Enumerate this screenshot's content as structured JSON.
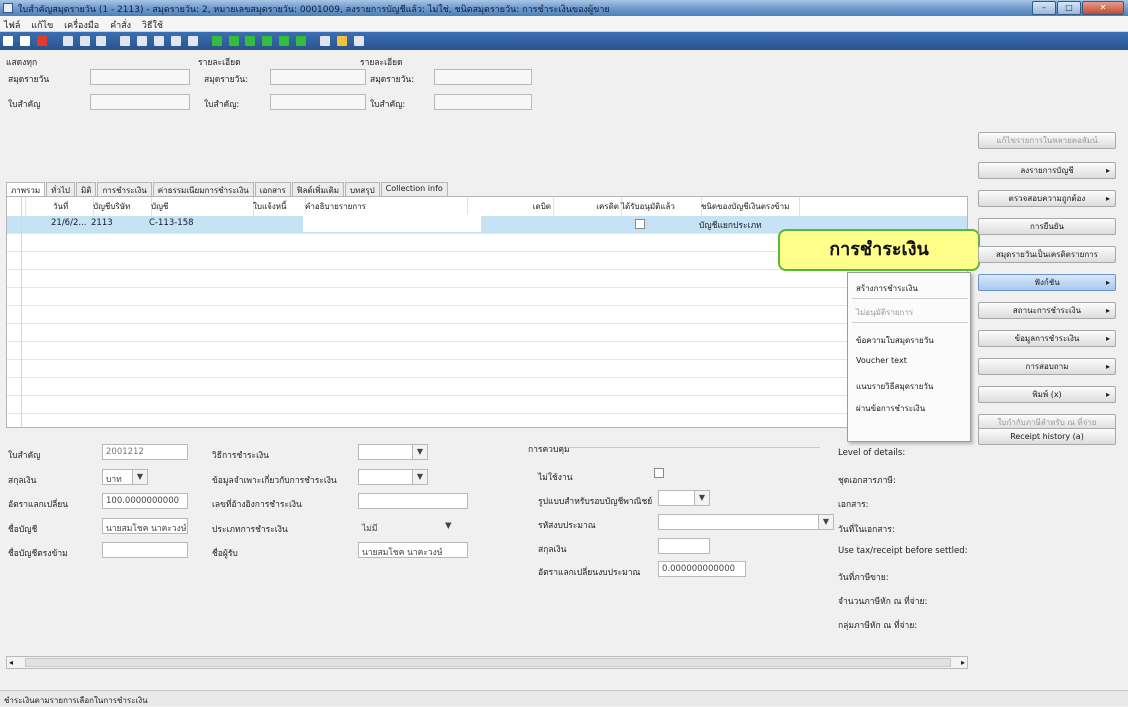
{
  "window": {
    "title": "ใบสำคัญสมุดรายวัน (1 - 2113) - สมุดรายวัน: 2, หมายเลขสมุดรายวัน: 0001009, ลงรายการบัญชีแล้ว: ไม่ใช่, ชนิดสมุดรายวัน: การชำระเงินของผู้ขาย",
    "controls": [
      "–",
      "□",
      "✕"
    ]
  },
  "menu": [
    "ไฟล์",
    "แก้ไข",
    "เครื่องมือ",
    "คำสั่ง",
    "วิธีใช้"
  ],
  "header_groups": {
    "g1": {
      "title": "แสดงทุก",
      "f1": "สมุดรายวัน",
      "f2": "ใบสำคัญ"
    },
    "g2": {
      "title": "รายละเอียด",
      "f1": "สมุดรายวัน:",
      "f2": "ใบสำคัญ:"
    },
    "g3": {
      "title": "รายละเอียด",
      "f1": "สมุดรายวัน:",
      "f2": "ใบสำคัญ:"
    }
  },
  "tabs": [
    "ภาพรวม",
    "ทั่วไป",
    "มิติ",
    "การชำระเงิน",
    "ค่าธรรมเนียมการชำระเงิน",
    "เอกสาร",
    "ฟิลด์เพิ่มเติม",
    "บทสรุป",
    "Collection info"
  ],
  "grid": {
    "headers": [
      "วันที่",
      "บัญชีบริษัท",
      "บัญชี",
      "ใบแจ้งหนี้",
      "คำอธิบายรายการ",
      "เดบิต",
      "เครดิต",
      "ได้รับอนุมัติแล้ว",
      "ชนิดของบัญชีเงินตรงข้าม"
    ],
    "rows": [
      {
        "date": "21/6/2...",
        "company": "2113",
        "account": "C-113-158",
        "offset_type": "บัญชีแยกประเภท"
      }
    ]
  },
  "callout": "การชำระเงิน",
  "popup": {
    "items": [
      {
        "label": "สร้างการชำระเงิน",
        "enabled": true
      },
      {
        "label": "ไม่อนุมัติรายการ",
        "enabled": false
      },
      {
        "label": "ข้อความใบสมุดรายวัน",
        "enabled": true
      },
      {
        "label": "Voucher text",
        "enabled": true
      },
      {
        "label": "แนบรายวิธีสมุดรายวัน",
        "enabled": true
      },
      {
        "label": "ผ่านข้อการชำระเงิน",
        "enabled": true
      }
    ]
  },
  "right_buttons": [
    {
      "label": "แก้ไขรายการในหลายคอลัมน์",
      "arrow": false,
      "state": "disabled"
    },
    {
      "label": "ลงรายการบัญชี",
      "arrow": true,
      "state": "normal"
    },
    {
      "label": "ตรวจสอบความถูกต้อง",
      "arrow": true,
      "state": "normal"
    },
    {
      "label": "การยืนยัน",
      "arrow": false,
      "state": "normal"
    },
    {
      "label": "สมุดรายวันเป็นเครดิตรายการ",
      "arrow": false,
      "state": "normal"
    },
    {
      "label": "ฟังก์ชัน",
      "arrow": true,
      "state": "selected"
    },
    {
      "label": "สถานะการชำระเงิน",
      "arrow": true,
      "state": "normal"
    },
    {
      "label": "ข้อมูลการชำระเงิน",
      "arrow": true,
      "state": "normal"
    },
    {
      "label": "การสอบถาม",
      "arrow": true,
      "state": "normal"
    },
    {
      "label": "พิมพ์ (x)",
      "arrow": true,
      "state": "normal"
    },
    {
      "label": "ใบกำกับภาษีสำหรับ ณ ที่จ่าย",
      "arrow": false,
      "state": "disabled"
    },
    {
      "label": "Receipt history (a)",
      "arrow": false,
      "state": "normal"
    }
  ],
  "detail": {
    "col1": {
      "voucher_label": "ใบสำคัญ",
      "voucher_value": "2001212",
      "currency_label": "สกุลเงิน",
      "currency_value": "บาท",
      "rate_label": "อัตราแลกเปลี่ยน",
      "rate_value": "100.0000000000",
      "account_label": "ชื่อบัญชี",
      "account_value": "นายสมโชค นาคะวงษ์",
      "offset_name_label": "ชื่อบัญชีตรงข้าม"
    },
    "col2": {
      "method_label": "วิธีการชำระเงิน",
      "spec_label": "ข้อมูลจำเพาะเกี่ยวกับการชำระเงิน",
      "ref_label": "เลขที่อ้างอิงการชำระเงิน",
      "type_label": "ประเภทการชำระเงิน",
      "type_value": "ไม่มี",
      "name_label": "ชื่อผู้รับ",
      "name_value": "นายสมโชค นาคะวงษ์"
    },
    "col3": {
      "title": "การควบคุม",
      "hold_label": "ไม่ใช้งาน",
      "reason_label": "รูปแบบสำหรับรอบบัญชีพาณิชย์",
      "budget_label": "รหัสงบประมาณ",
      "amount_label": "สกุลเงิน",
      "budget_rate_label": "อัตราแลกเปลี่ยนงบประมาณ",
      "budget_rate_value": "0.000000000000"
    },
    "col4": {
      "level": "Level of details:",
      "l2": "ชุดเอกสารภาษี:",
      "l3": "เอกสาร:",
      "l4": "วันที่ในเอกสาร:",
      "l5": "Use tax/receipt before settled:",
      "l6": "วันที่ภาษีขาย:",
      "l7": "จำนวนภาษีหัก ณ ที่จ่าย:",
      "l8": "กลุ่มภาษีหัก ณ ที่จ่าย:"
    }
  },
  "status": "ชำระเงินตามรายการเลือกในการชำระเงิน"
}
